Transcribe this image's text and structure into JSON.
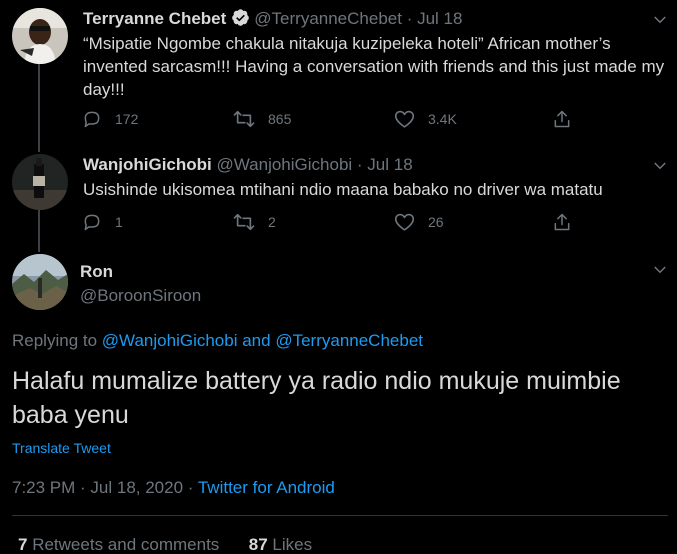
{
  "tweets": [
    {
      "display_name": "Terryanne Chebet",
      "handle": "@TerryanneChebet",
      "date": "· Jul 18",
      "text": "“Msipatie Ngombe chakula nitakuja kuzipeleka hoteli” African mother’s invented sarcasm!!!  Having a conversation with friends and this just made my day!!!",
      "replies": "172",
      "retweets": "865",
      "likes": "3.4K"
    },
    {
      "display_name": "WanjohiGichobi",
      "handle": "@WanjohiGichobi",
      "date": "· Jul 18",
      "text": "Usishinde ukisomea mtihani ndio maana babako no driver wa matatu",
      "replies": "1",
      "retweets": "2",
      "likes": "26"
    }
  ],
  "main_tweet": {
    "display_name": "Ron",
    "handle": "@BoroonSiroon",
    "replying_prefix": "Replying to",
    "replying_user1": "@WanjohiGichobi",
    "replying_and": "and",
    "replying_user2": "@TerryanneChebet",
    "text": "Halafu mumalize battery ya radio ndio mukuje muimbie baba yenu",
    "translate": "Translate Tweet",
    "timestamp": "7:23 PM · Jul 18, 2020 ·",
    "source": "Twitter for Android",
    "retweet_count": "7",
    "retweet_label": "Retweets and comments",
    "like_count": "87",
    "like_label": "Likes"
  },
  "icons": {
    "verified": "verified-badge-icon",
    "caret": "chevron-down-icon",
    "reply": "reply-icon",
    "retweet": "retweet-icon",
    "like": "heart-icon",
    "share": "share-icon"
  },
  "colors": {
    "background": "#000000",
    "link": "#1d9bf0",
    "muted": "#6e767d"
  }
}
